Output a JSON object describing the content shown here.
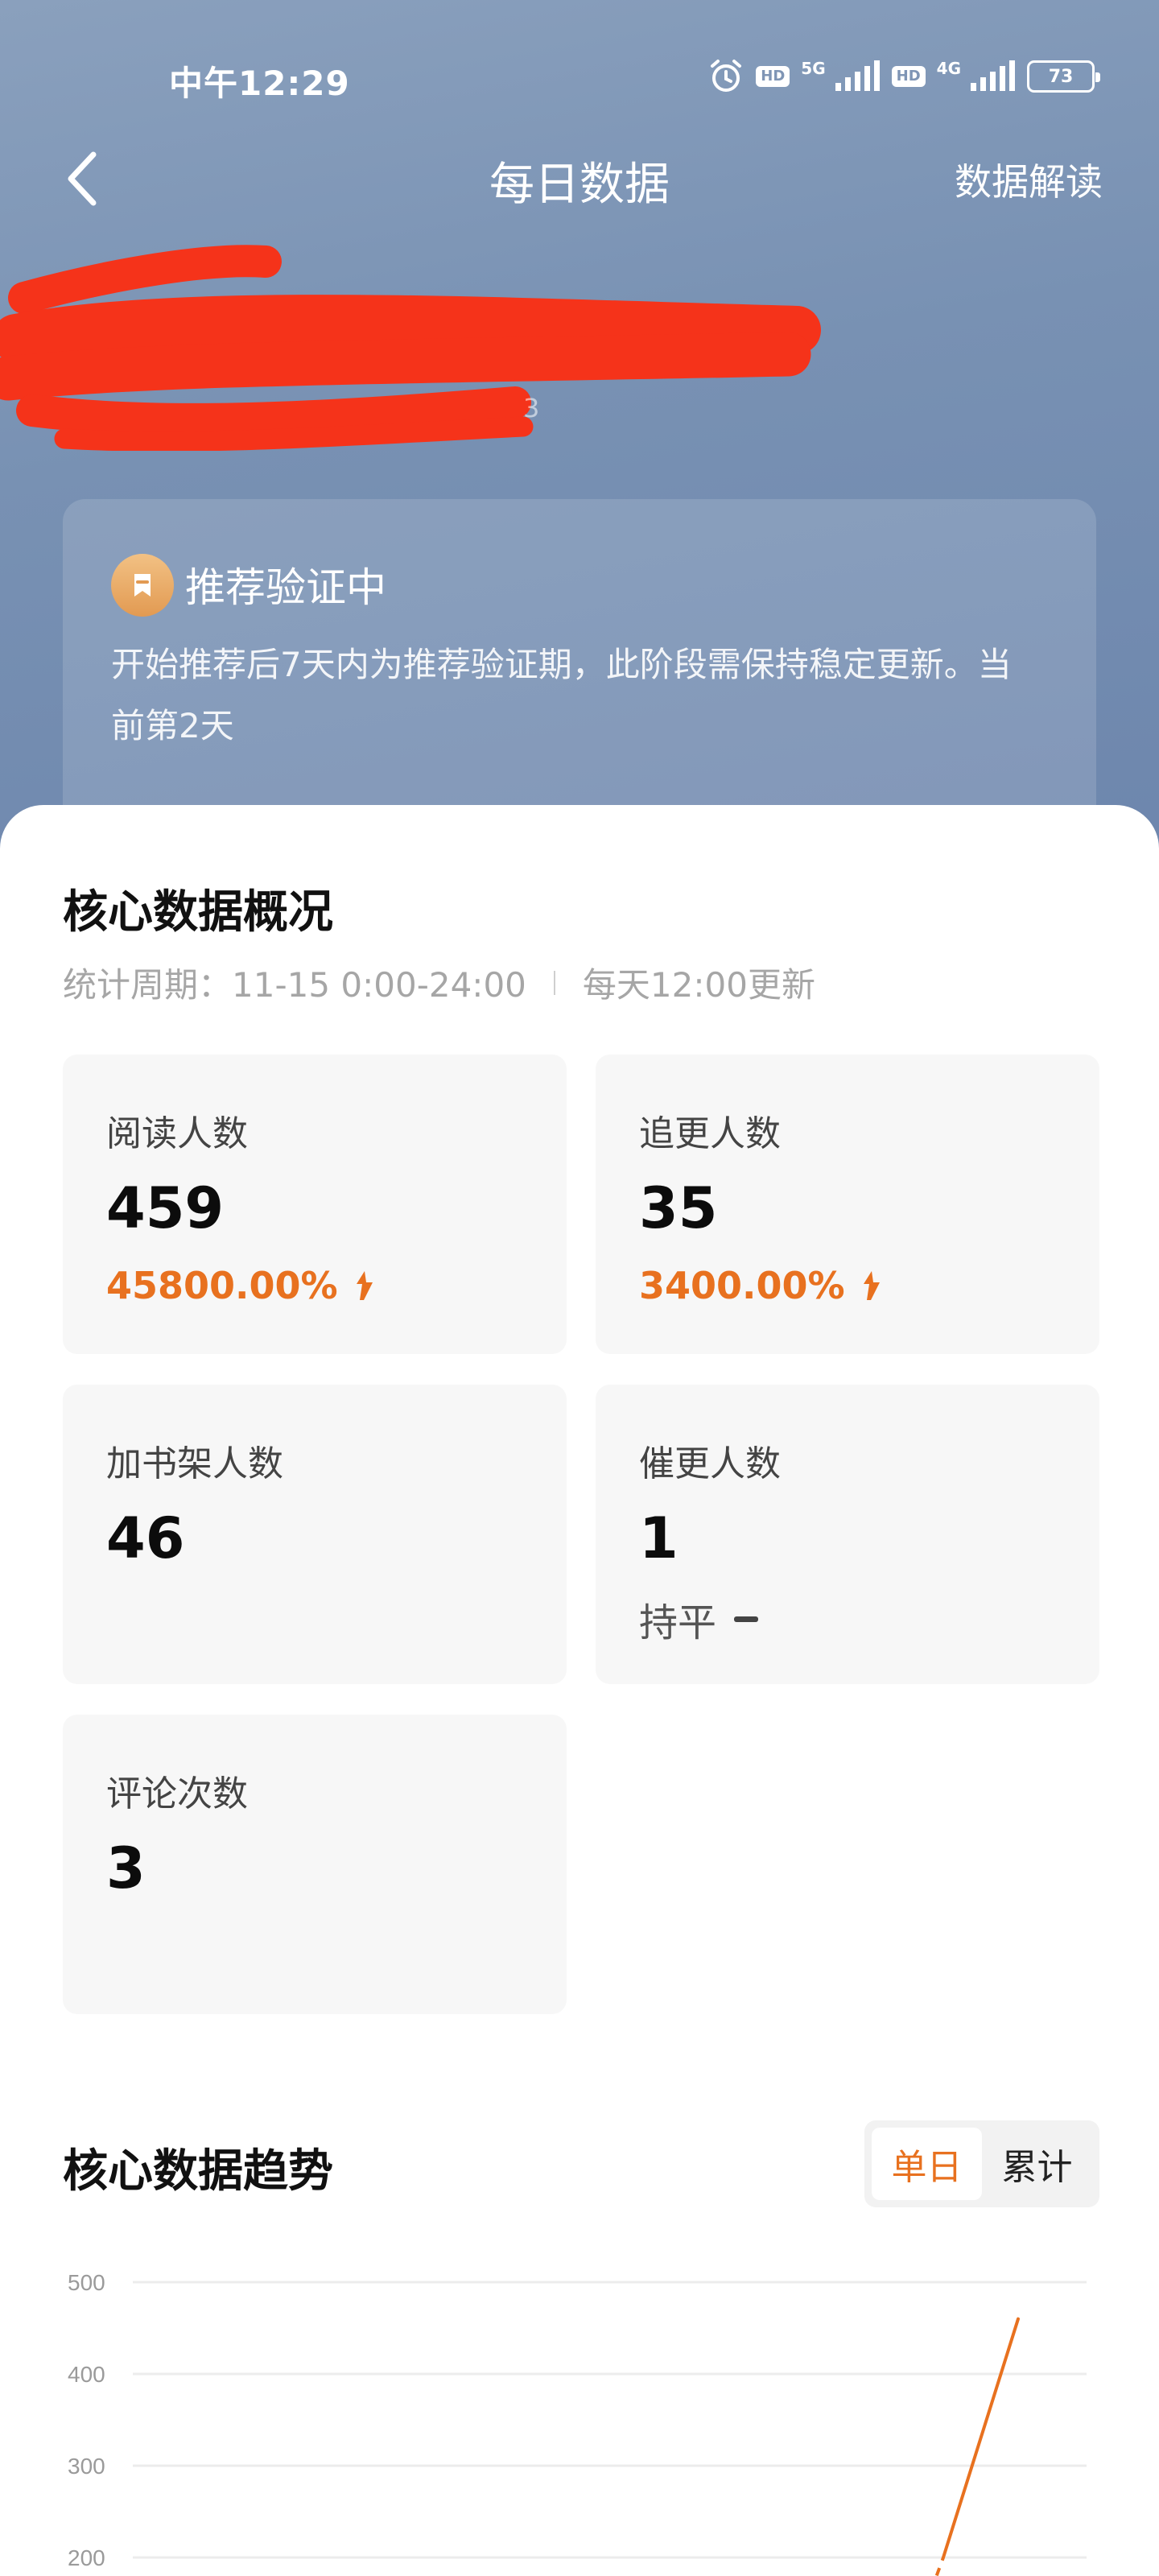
{
  "status_bar": {
    "time": "中午12:29",
    "hd_label": "HD",
    "net_5g": "5G",
    "net_4g": "4G",
    "battery": "73"
  },
  "nav": {
    "title": "每日数据",
    "action": "数据解读"
  },
  "redaction_trail": "3",
  "recommend": {
    "title": "推荐验证中",
    "description": "开始推荐后7天内为推荐验证期，此阶段需保持稳定更新。当前第2天"
  },
  "core_overview": {
    "title": "核心数据概况",
    "period": "统计周期：11-15 0:00-24:00",
    "update_note": "每天12:00更新",
    "stats": [
      {
        "label": "阅读人数",
        "value": "459",
        "change": "45800.00%",
        "trend": "up"
      },
      {
        "label": "追更人数",
        "value": "35",
        "change": "3400.00%",
        "trend": "up"
      },
      {
        "label": "加书架人数",
        "value": "46"
      },
      {
        "label": "催更人数",
        "value": "1",
        "change": "持平",
        "trend": "flat"
      },
      {
        "label": "评论次数",
        "value": "3"
      }
    ]
  },
  "core_trend": {
    "title": "核心数据趋势",
    "toggle": [
      "单日",
      "累计"
    ],
    "active_toggle": "单日"
  },
  "colors": {
    "accent": "#e8711f",
    "hero_top": "#8aa0bd",
    "hero_bottom": "#6d86ad",
    "redaction": "#f5331a"
  },
  "chart_data": {
    "type": "line",
    "y_ticks": [
      "500",
      "400",
      "300",
      "200"
    ],
    "ylim": [
      200,
      500
    ],
    "grid": true,
    "series": [
      {
        "values": [
          200,
          460
        ],
        "segment_style": "line ending at ~460 at the right edge of the visible chart"
      }
    ]
  }
}
